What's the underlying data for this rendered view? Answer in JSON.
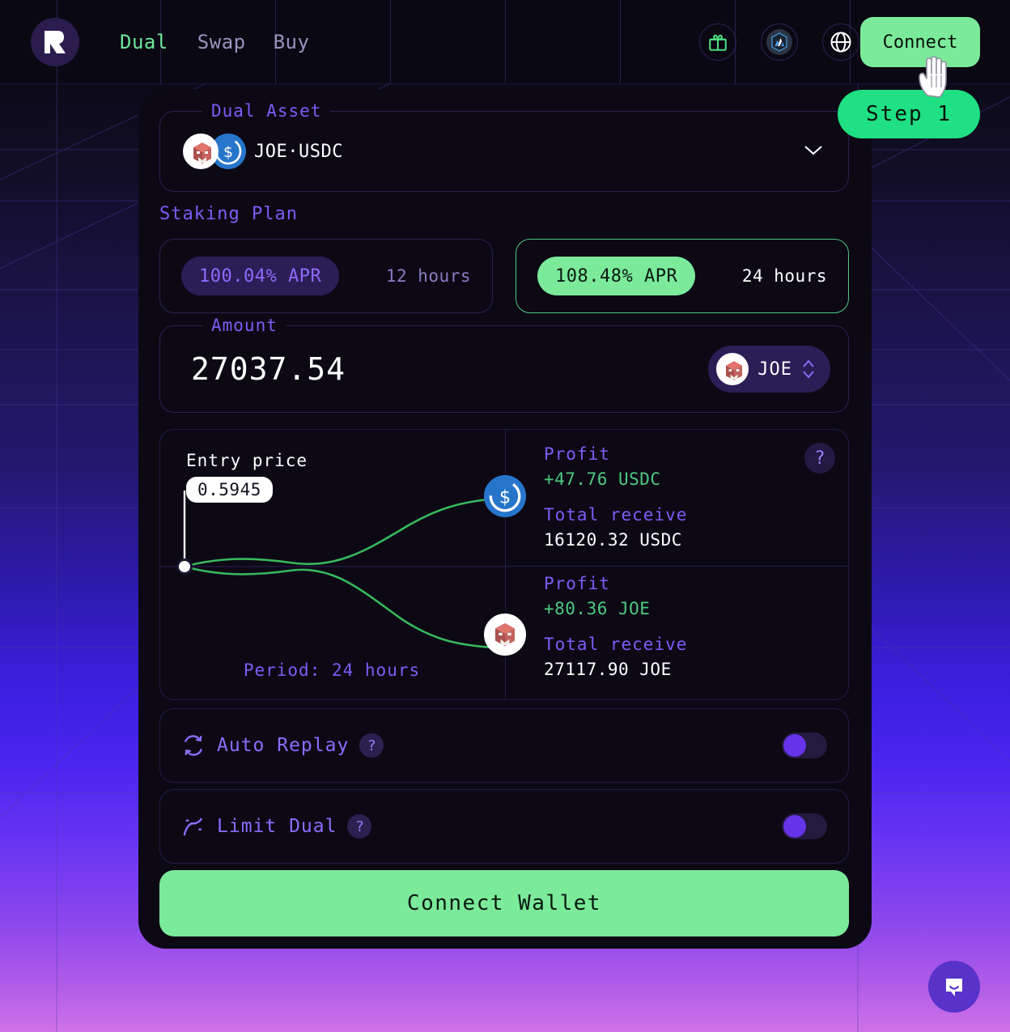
{
  "header": {
    "logo_alt": "rango-logo",
    "nav": [
      {
        "label": "Dual",
        "active": true
      },
      {
        "label": "Swap",
        "active": false
      },
      {
        "label": "Buy",
        "active": false
      }
    ],
    "icons": [
      {
        "name": "gift-icon"
      },
      {
        "name": "chain-badge-icon"
      },
      {
        "name": "globe-icon"
      }
    ],
    "connect_label": "Connect"
  },
  "step_badge": {
    "label": "Step 1"
  },
  "cursor": {
    "name": "hand-cursor"
  },
  "card": {
    "asset": {
      "legend": "Dual Asset",
      "pair": "JOE·USDC",
      "chevron": "chevron-down-icon"
    },
    "staking_plan": {
      "label": "Staking Plan",
      "plans": [
        {
          "apr": "100.04% APR",
          "duration": "12 hours",
          "selected": false
        },
        {
          "apr": "108.48% APR",
          "duration": "24 hours",
          "selected": true
        }
      ]
    },
    "amount": {
      "legend": "Amount",
      "value": "27037.54",
      "token": "JOE"
    },
    "payoff": {
      "entry_label": "Entry price",
      "entry_price": "0.5945",
      "period": "Period: 24 hours",
      "help": "?",
      "outcomes": [
        {
          "profit_label": "Profit",
          "profit_value": "+47.76 USDC",
          "total_label": "Total receive",
          "total_value": "16120.32 USDC",
          "token_icon": "usdc-token-icon"
        },
        {
          "profit_label": "Profit",
          "profit_value": "+80.36 JOE",
          "total_label": "Total receive",
          "total_value": "27117.90 JOE",
          "token_icon": "joe-token-icon"
        }
      ]
    },
    "options": [
      {
        "label": "Auto Replay",
        "help": "?",
        "enabled": false,
        "icon": "refresh-icon"
      },
      {
        "label": "Limit Dual",
        "help": "?",
        "enabled": false,
        "icon": "limit-curve-icon"
      }
    ],
    "cta_label": "Connect Wallet"
  },
  "chat": {
    "name": "chat-launcher-icon"
  },
  "colors": {
    "accent_green": "#7bea9b",
    "bright_green": "#1fe082",
    "purple": "#7d5cf6",
    "knob_purple": "#6533e8",
    "card_bg": "#0c0915",
    "usdc_blue": "#2775ca"
  }
}
